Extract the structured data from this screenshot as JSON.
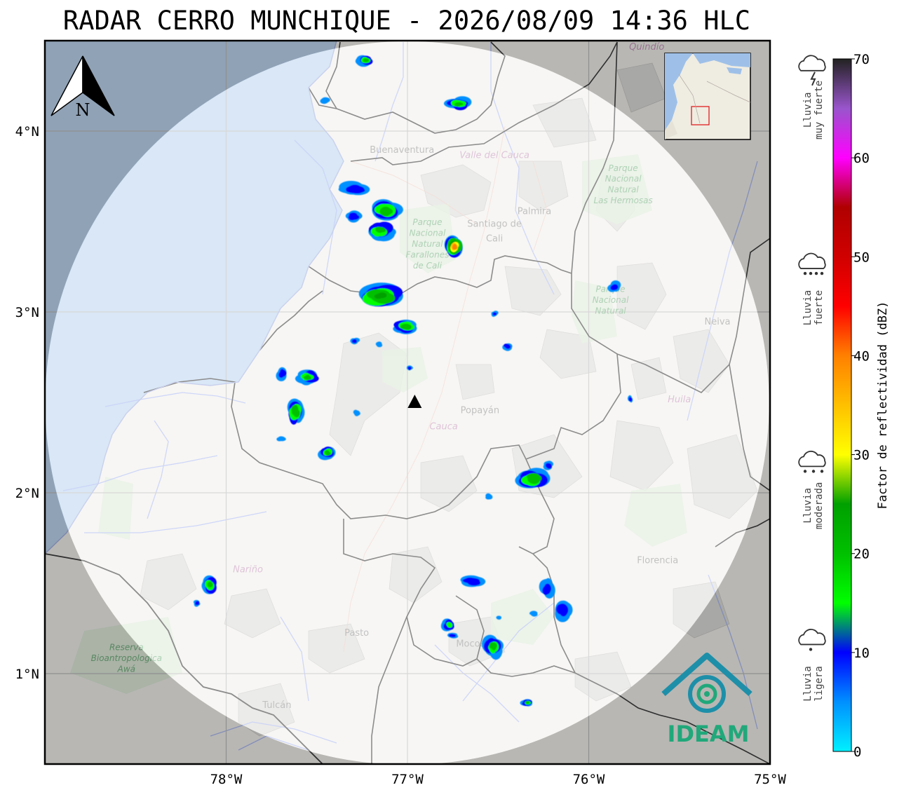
{
  "title": "RADAR CERRO MUNCHIQUE - 2026/08/09 14:36 HLC",
  "map": {
    "lon_range": [
      -79.0,
      -75.0
    ],
    "lat_range": [
      0.5,
      4.5
    ],
    "lat_ticks": [
      {
        "value": 4,
        "label": "4°N"
      },
      {
        "value": 3,
        "label": "3°N"
      },
      {
        "value": 2,
        "label": "2°N"
      },
      {
        "value": 1,
        "label": "1°N"
      }
    ],
    "lon_ticks": [
      {
        "value": -78,
        "label": "78°W"
      },
      {
        "value": -77,
        "label": "77°W"
      },
      {
        "value": -76,
        "label": "76°W"
      },
      {
        "value": -75,
        "label": "75°W"
      }
    ],
    "radar_site": {
      "lon": -76.96,
      "lat": 2.5
    },
    "north_arrow_label": "N",
    "places": [
      {
        "name": "Santiago de",
        "lon": -76.52,
        "lat": 3.47,
        "kind": "city"
      },
      {
        "name": "Cali",
        "lon": -76.52,
        "lat": 3.39,
        "kind": "city"
      },
      {
        "name": "Palmira",
        "lon": -76.3,
        "lat": 3.54,
        "kind": "city"
      },
      {
        "name": "Buenaventura",
        "lon": -77.03,
        "lat": 3.88,
        "kind": "city"
      },
      {
        "name": "Popayán",
        "lon": -76.6,
        "lat": 2.44,
        "kind": "city"
      },
      {
        "name": "Pasto",
        "lon": -77.28,
        "lat": 1.21,
        "kind": "city"
      },
      {
        "name": "Neiva",
        "lon": -75.29,
        "lat": 2.93,
        "kind": "city"
      },
      {
        "name": "Florencia",
        "lon": -75.62,
        "lat": 1.61,
        "kind": "city"
      },
      {
        "name": "Tulcán",
        "lon": -77.72,
        "lat": 0.81,
        "kind": "city"
      },
      {
        "name": "Mocoa",
        "lon": -76.65,
        "lat": 1.15,
        "kind": "city"
      },
      {
        "name": "Valle del Cauca",
        "lon": -76.52,
        "lat": 3.85,
        "kind": "dept"
      },
      {
        "name": "Cauca",
        "lon": -76.8,
        "lat": 2.35,
        "kind": "dept"
      },
      {
        "name": "Huila",
        "lon": -75.5,
        "lat": 2.5,
        "kind": "dept"
      },
      {
        "name": "Nariño",
        "lon": -77.88,
        "lat": 1.56,
        "kind": "dept"
      },
      {
        "name": "Quindío",
        "lon": -75.68,
        "lat": 4.45,
        "kind": "dept"
      },
      {
        "name": "Parque",
        "lon": -76.89,
        "lat": 3.48,
        "kind": "park"
      },
      {
        "name": "Nacional",
        "lon": -76.89,
        "lat": 3.42,
        "kind": "park"
      },
      {
        "name": "Natural",
        "lon": -76.89,
        "lat": 3.36,
        "kind": "park"
      },
      {
        "name": "Farallones",
        "lon": -76.89,
        "lat": 3.3,
        "kind": "park"
      },
      {
        "name": "de Cali",
        "lon": -76.89,
        "lat": 3.24,
        "kind": "park"
      },
      {
        "name": "Parque",
        "lon": -75.81,
        "lat": 3.78,
        "kind": "park"
      },
      {
        "name": "Nacional",
        "lon": -75.81,
        "lat": 3.72,
        "kind": "park"
      },
      {
        "name": "Natural",
        "lon": -75.81,
        "lat": 3.66,
        "kind": "park"
      },
      {
        "name": "Las Hermosas",
        "lon": -75.81,
        "lat": 3.6,
        "kind": "park"
      },
      {
        "name": "Parque",
        "lon": -75.88,
        "lat": 3.11,
        "kind": "park"
      },
      {
        "name": "Nacional",
        "lon": -75.88,
        "lat": 3.05,
        "kind": "park"
      },
      {
        "name": "Natural",
        "lon": -75.88,
        "lat": 2.99,
        "kind": "park"
      },
      {
        "name": "Reserva",
        "lon": -78.55,
        "lat": 1.13,
        "kind": "park"
      },
      {
        "name": "Bioantropologica",
        "lon": -78.55,
        "lat": 1.07,
        "kind": "park"
      },
      {
        "name": "Awá",
        "lon": -78.55,
        "lat": 1.01,
        "kind": "park"
      }
    ],
    "echoes": [
      {
        "lon": -77.23,
        "lat": 4.39,
        "rx": 14,
        "ry": 9,
        "peak": 20
      },
      {
        "lon": -76.72,
        "lat": 4.15,
        "rx": 20,
        "ry": 10,
        "peak": 21
      },
      {
        "lon": -77.45,
        "lat": 4.17,
        "rx": 8,
        "ry": 5,
        "peak": 10
      },
      {
        "lon": -77.3,
        "lat": 3.68,
        "rx": 26,
        "ry": 11,
        "peak": 12
      },
      {
        "lon": -77.12,
        "lat": 3.56,
        "rx": 22,
        "ry": 17,
        "peak": 24
      },
      {
        "lon": -77.15,
        "lat": 3.45,
        "rx": 22,
        "ry": 14,
        "peak": 21
      },
      {
        "lon": -77.3,
        "lat": 3.53,
        "rx": 14,
        "ry": 9,
        "peak": 12
      },
      {
        "lon": -76.74,
        "lat": 3.36,
        "rx": 14,
        "ry": 16,
        "peak": 45
      },
      {
        "lon": -77.15,
        "lat": 3.09,
        "rx": 38,
        "ry": 21,
        "peak": 28
      },
      {
        "lon": -77.01,
        "lat": 2.92,
        "rx": 18,
        "ry": 10,
        "peak": 24
      },
      {
        "lon": -77.29,
        "lat": 2.84,
        "rx": 7,
        "ry": 5,
        "peak": 12
      },
      {
        "lon": -77.16,
        "lat": 2.82,
        "rx": 5,
        "ry": 4,
        "peak": 10
      },
      {
        "lon": -76.45,
        "lat": 2.81,
        "rx": 8,
        "ry": 6,
        "peak": 12
      },
      {
        "lon": -76.52,
        "lat": 2.99,
        "rx": 5,
        "ry": 4,
        "peak": 15
      },
      {
        "lon": -75.86,
        "lat": 3.14,
        "rx": 9,
        "ry": 9,
        "peak": 12
      },
      {
        "lon": -77.55,
        "lat": 2.64,
        "rx": 18,
        "ry": 12,
        "peak": 22
      },
      {
        "lon": -77.62,
        "lat": 2.45,
        "rx": 14,
        "ry": 20,
        "peak": 24
      },
      {
        "lon": -77.69,
        "lat": 2.66,
        "rx": 9,
        "ry": 10,
        "peak": 12
      },
      {
        "lon": -77.7,
        "lat": 2.3,
        "rx": 7,
        "ry": 5,
        "peak": 11
      },
      {
        "lon": -77.44,
        "lat": 2.22,
        "rx": 12,
        "ry": 10,
        "peak": 20
      },
      {
        "lon": -77.28,
        "lat": 2.44,
        "rx": 6,
        "ry": 5,
        "peak": 10
      },
      {
        "lon": -76.99,
        "lat": 2.69,
        "rx": 5,
        "ry": 4,
        "peak": 12
      },
      {
        "lon": -76.3,
        "lat": 2.08,
        "rx": 26,
        "ry": 15,
        "peak": 24
      },
      {
        "lon": -76.22,
        "lat": 2.15,
        "rx": 8,
        "ry": 7,
        "peak": 12
      },
      {
        "lon": -76.55,
        "lat": 1.98,
        "rx": 5,
        "ry": 5,
        "peak": 10
      },
      {
        "lon": -75.77,
        "lat": 2.52,
        "rx": 4,
        "ry": 6,
        "peak": 15
      },
      {
        "lon": -76.65,
        "lat": 1.51,
        "rx": 22,
        "ry": 9,
        "peak": 12
      },
      {
        "lon": -76.77,
        "lat": 1.27,
        "rx": 12,
        "ry": 9,
        "peak": 18
      },
      {
        "lon": -76.53,
        "lat": 1.15,
        "rx": 16,
        "ry": 16,
        "peak": 22
      },
      {
        "lon": -76.75,
        "lat": 1.21,
        "rx": 8,
        "ry": 4,
        "peak": 12
      },
      {
        "lon": -76.23,
        "lat": 1.47,
        "rx": 10,
        "ry": 15,
        "peak": 12
      },
      {
        "lon": -76.15,
        "lat": 1.35,
        "rx": 16,
        "ry": 18,
        "peak": 12
      },
      {
        "lon": -76.3,
        "lat": 1.33,
        "rx": 7,
        "ry": 4,
        "peak": 10
      },
      {
        "lon": -78.09,
        "lat": 1.49,
        "rx": 13,
        "ry": 15,
        "peak": 22
      },
      {
        "lon": -78.16,
        "lat": 1.39,
        "rx": 5,
        "ry": 5,
        "peak": 12
      },
      {
        "lon": -76.34,
        "lat": 0.84,
        "rx": 10,
        "ry": 6,
        "peak": 20
      },
      {
        "lon": -76.5,
        "lat": 1.31,
        "rx": 5,
        "ry": 3,
        "peak": 10
      }
    ]
  },
  "colorbar": {
    "label": "Factor de reflectividad (dBZ)",
    "min": 0,
    "max": 70,
    "ticks": [
      0,
      10,
      20,
      30,
      40,
      50,
      60,
      70
    ],
    "stops": [
      {
        "v": 0,
        "c": "#00f0ff"
      },
      {
        "v": 5,
        "c": "#0090ff"
      },
      {
        "v": 10,
        "c": "#0000ff"
      },
      {
        "v": 15,
        "c": "#00ff00"
      },
      {
        "v": 20,
        "c": "#00c000"
      },
      {
        "v": 25,
        "c": "#00a000"
      },
      {
        "v": 30,
        "c": "#ffff00"
      },
      {
        "v": 35,
        "c": "#ffc000"
      },
      {
        "v": 40,
        "c": "#ff8000"
      },
      {
        "v": 45,
        "c": "#ff0000"
      },
      {
        "v": 50,
        "c": "#d00000"
      },
      {
        "v": 55,
        "c": "#b00000"
      },
      {
        "v": 60,
        "c": "#ff00ff"
      },
      {
        "v": 65,
        "c": "#9955cc"
      },
      {
        "v": 70,
        "c": "#222222"
      }
    ]
  },
  "intensity_legend": [
    {
      "line1": "Lluvia",
      "line2": "muy fuerte",
      "icon": "storm-cloud-icon",
      "value": 63
    },
    {
      "line1": "Lluvia",
      "line2": "fuerte",
      "icon": "heavy-rain-cloud-icon",
      "value": 43
    },
    {
      "line1": "Lluvia",
      "line2": "moderada",
      "icon": "moderate-rain-cloud-icon",
      "value": 23
    },
    {
      "line1": "Lluvia",
      "line2": "ligera",
      "icon": "light-rain-cloud-icon",
      "value": 5
    }
  ],
  "logo_text": "IDEAM",
  "colors": {
    "land": "#f3f2ef",
    "sea": "#a9c8ea",
    "coverage": "#ffffff",
    "outside": "#8a8a8a",
    "logo": "#21a87a"
  }
}
